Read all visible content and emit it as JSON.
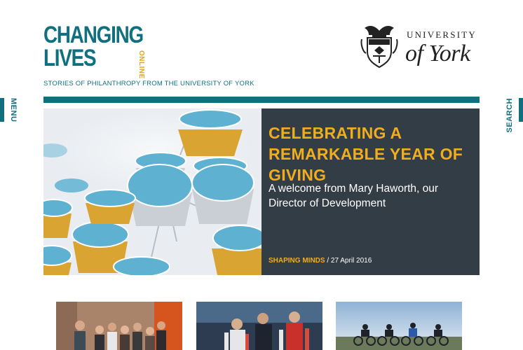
{
  "nav": {
    "menu_label": "MENU",
    "search_label": "SEARCH"
  },
  "brand": {
    "line1": "CHANGING",
    "line2": "LIVES",
    "online": "ONLINE",
    "tagline": "STORIES OF PHILANTHROPY FROM THE UNIVERSITY OF YORK"
  },
  "university": {
    "line1": "UNIVERSITY",
    "line2": "of York"
  },
  "hero": {
    "title": "CELEBRATING A REMARKABLE YEAR OF GIVING",
    "subtitle": "A welcome from Mary Haworth, our Director of Development",
    "category": "SHAPING MINDS",
    "separator": " / ",
    "date": "27 April 2016"
  },
  "colors": {
    "teal": "#11707f",
    "gold": "#f0ad1e",
    "panel": "#333d46"
  }
}
